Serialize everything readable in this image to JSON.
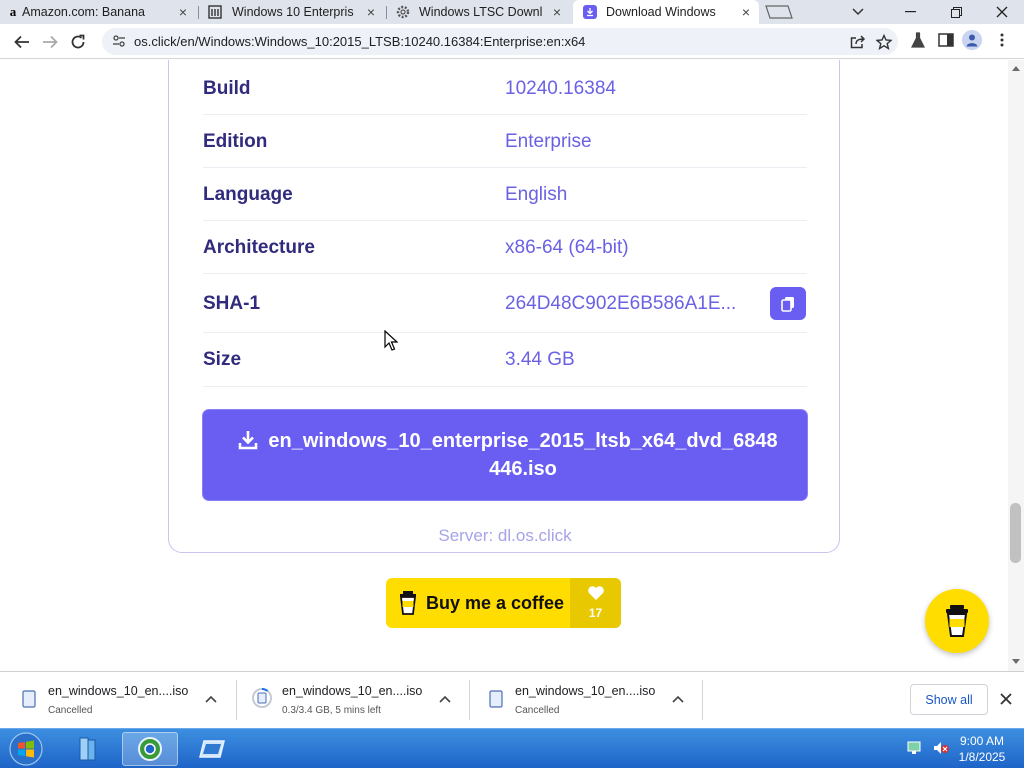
{
  "tabs": [
    {
      "title": "Amazon.com: Banana",
      "favicon": "amazon-a-icon",
      "active": false
    },
    {
      "title": "Windows 10 Enterpris",
      "favicon": "building-icon",
      "active": false
    },
    {
      "title": "Windows LTSC Downl",
      "favicon": "gear-icon",
      "active": false
    },
    {
      "title": "Download Windows",
      "favicon": "download-icon",
      "active": true
    }
  ],
  "address_bar": {
    "url": "os.click/en/Windows:Windows_10:2015_LTSB:10240.16384:Enterprise:en:x64"
  },
  "details": [
    {
      "label": "Build",
      "value": "10240.16384"
    },
    {
      "label": "Edition",
      "value": "Enterprise"
    },
    {
      "label": "Language",
      "value": "English"
    },
    {
      "label": "Architecture",
      "value": "x86-64 (64-bit)"
    },
    {
      "label": "SHA-1",
      "value": "264D48C902E6B586A1E...",
      "copy_icon": "copy-icon"
    },
    {
      "label": "Size",
      "value": "3.44 GB"
    }
  ],
  "download": {
    "filename": "en_windows_10_enterprise_2015_ltsb_x64_dvd_6848446.iso",
    "server": "Server: dl.os.click"
  },
  "coffee": {
    "label": "Buy me a coffee",
    "count": "17"
  },
  "downloads_shelf": {
    "items": [
      {
        "name": "en_windows_10_en....iso",
        "status": "Cancelled"
      },
      {
        "name": "en_windows_10_en....iso",
        "status": "0.3/3.4 GB, 5 mins left"
      },
      {
        "name": "en_windows_10_en....iso",
        "status": "Cancelled"
      }
    ],
    "show_all": "Show all"
  },
  "taskbar": {
    "time": "9:00 AM",
    "date": "1/8/2025"
  },
  "colors": {
    "accent": "#6a5ef2",
    "label_text": "#312b7d",
    "value_text": "#6a61e4",
    "coffee_yellow": "#ffdd00"
  }
}
